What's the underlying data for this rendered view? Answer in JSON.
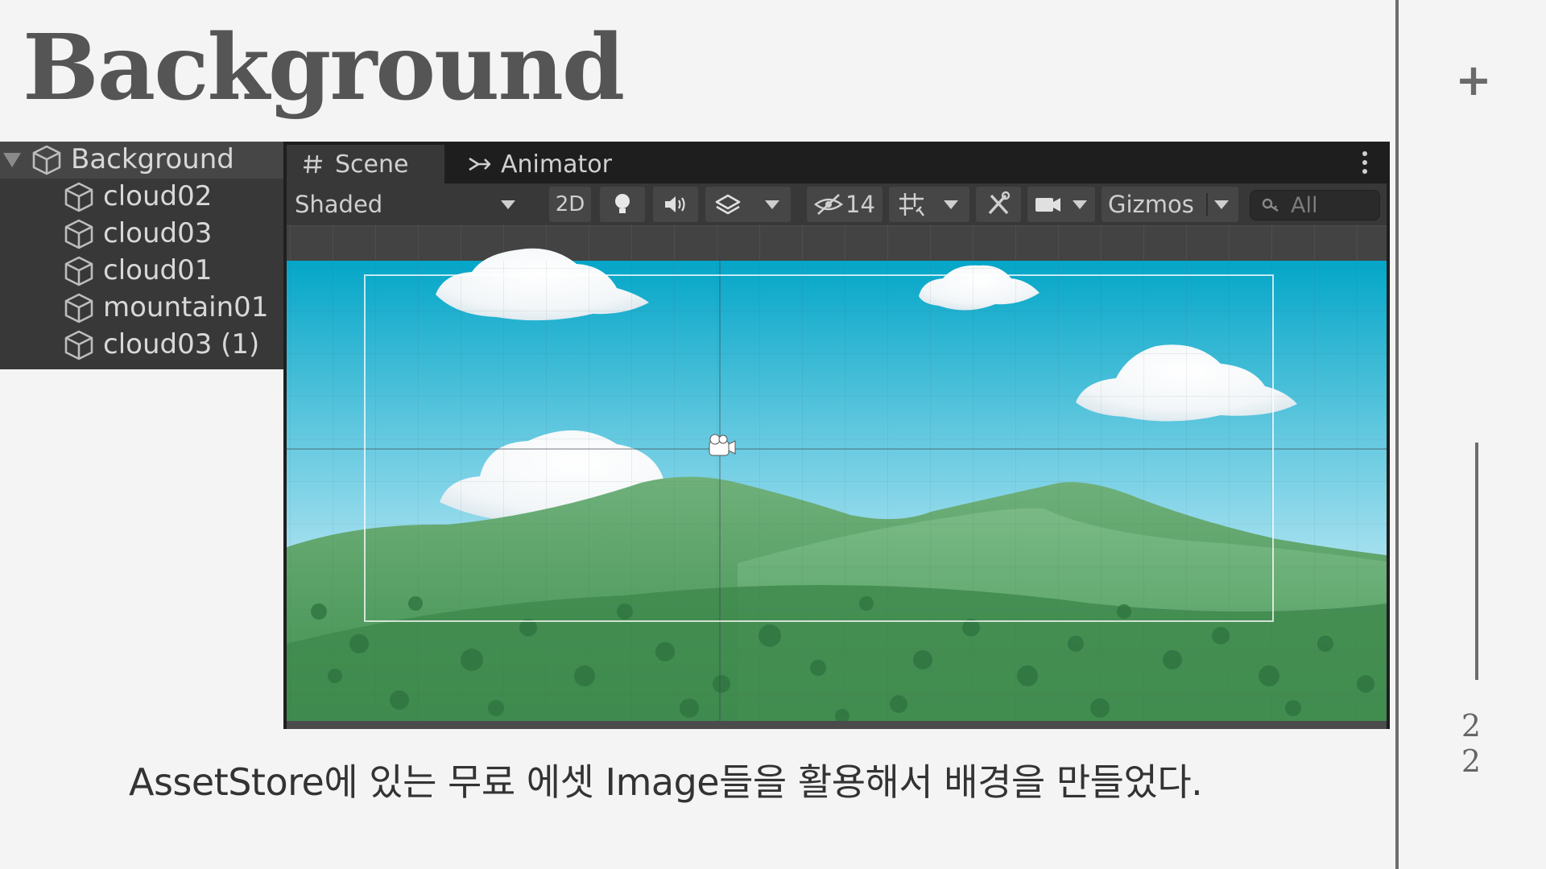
{
  "slide": {
    "title": "Background",
    "add_label": "+",
    "page_number": "22",
    "caption": "AssetStore에 있는 무료 에셋 Image들을 활용해서 배경을 만들었다."
  },
  "hierarchy": {
    "root": "Background",
    "items": [
      "cloud02",
      "cloud03",
      "cloud01",
      "mountain01",
      "cloud03 (1)"
    ]
  },
  "editor": {
    "tabs": [
      {
        "label": "Scene",
        "icon": "grid-hash-icon",
        "active": true
      },
      {
        "label": "Animator",
        "icon": "animator-icon",
        "active": false
      }
    ],
    "toolbar": {
      "shading_mode": "Shaded",
      "mode_2d": "2D",
      "hidden_count": "14",
      "gizmos": "Gizmos",
      "search_placeholder": "All"
    }
  },
  "colors": {
    "sky_top": "#04a6c8",
    "sky_bottom": "#ffffff",
    "hill_green": "#4f9a5a",
    "editor_dark": "#383838"
  }
}
